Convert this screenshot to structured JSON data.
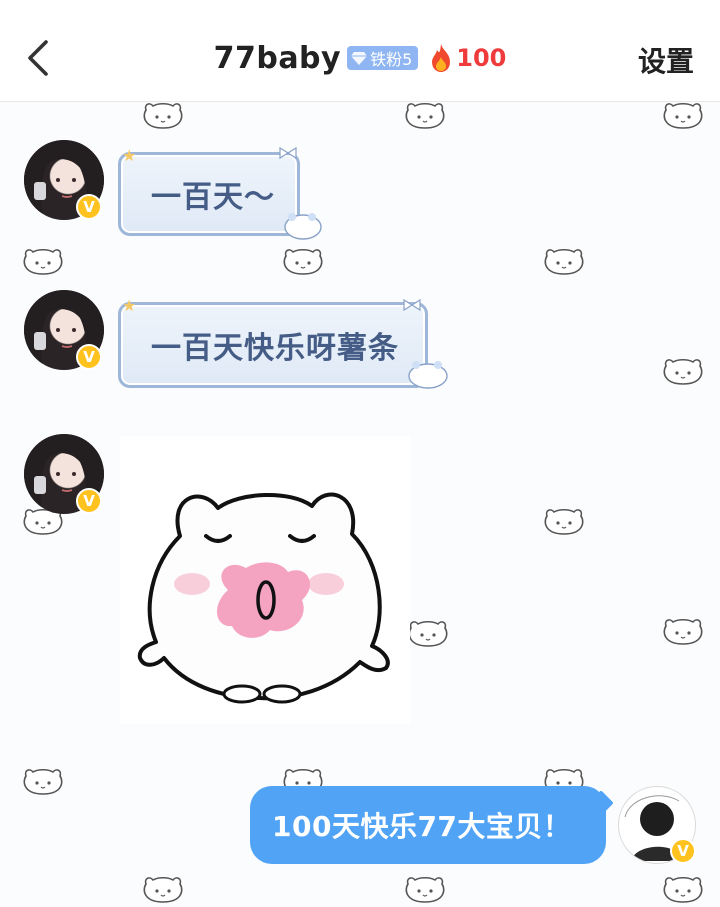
{
  "header": {
    "title": "77baby",
    "fan_badge": "铁粉5",
    "fire_count": "100",
    "settings_label": "设置"
  },
  "messages": [
    {
      "sender": "other",
      "type": "text-card",
      "text": "一百天～"
    },
    {
      "sender": "other",
      "type": "text-card",
      "text": "一百天快乐呀薯条"
    },
    {
      "sender": "other",
      "type": "sticker",
      "sticker": "pink-nose-bear-sticker"
    },
    {
      "sender": "me",
      "type": "text",
      "text": "100天快乐77大宝贝！"
    }
  ],
  "colors": {
    "accent_blue": "#51a3f5",
    "fire_red": "#ef3b3b",
    "vip_yellow": "#ffc21f",
    "card_text": "#455d86",
    "fan_badge_bg": "#8fb6f2"
  }
}
